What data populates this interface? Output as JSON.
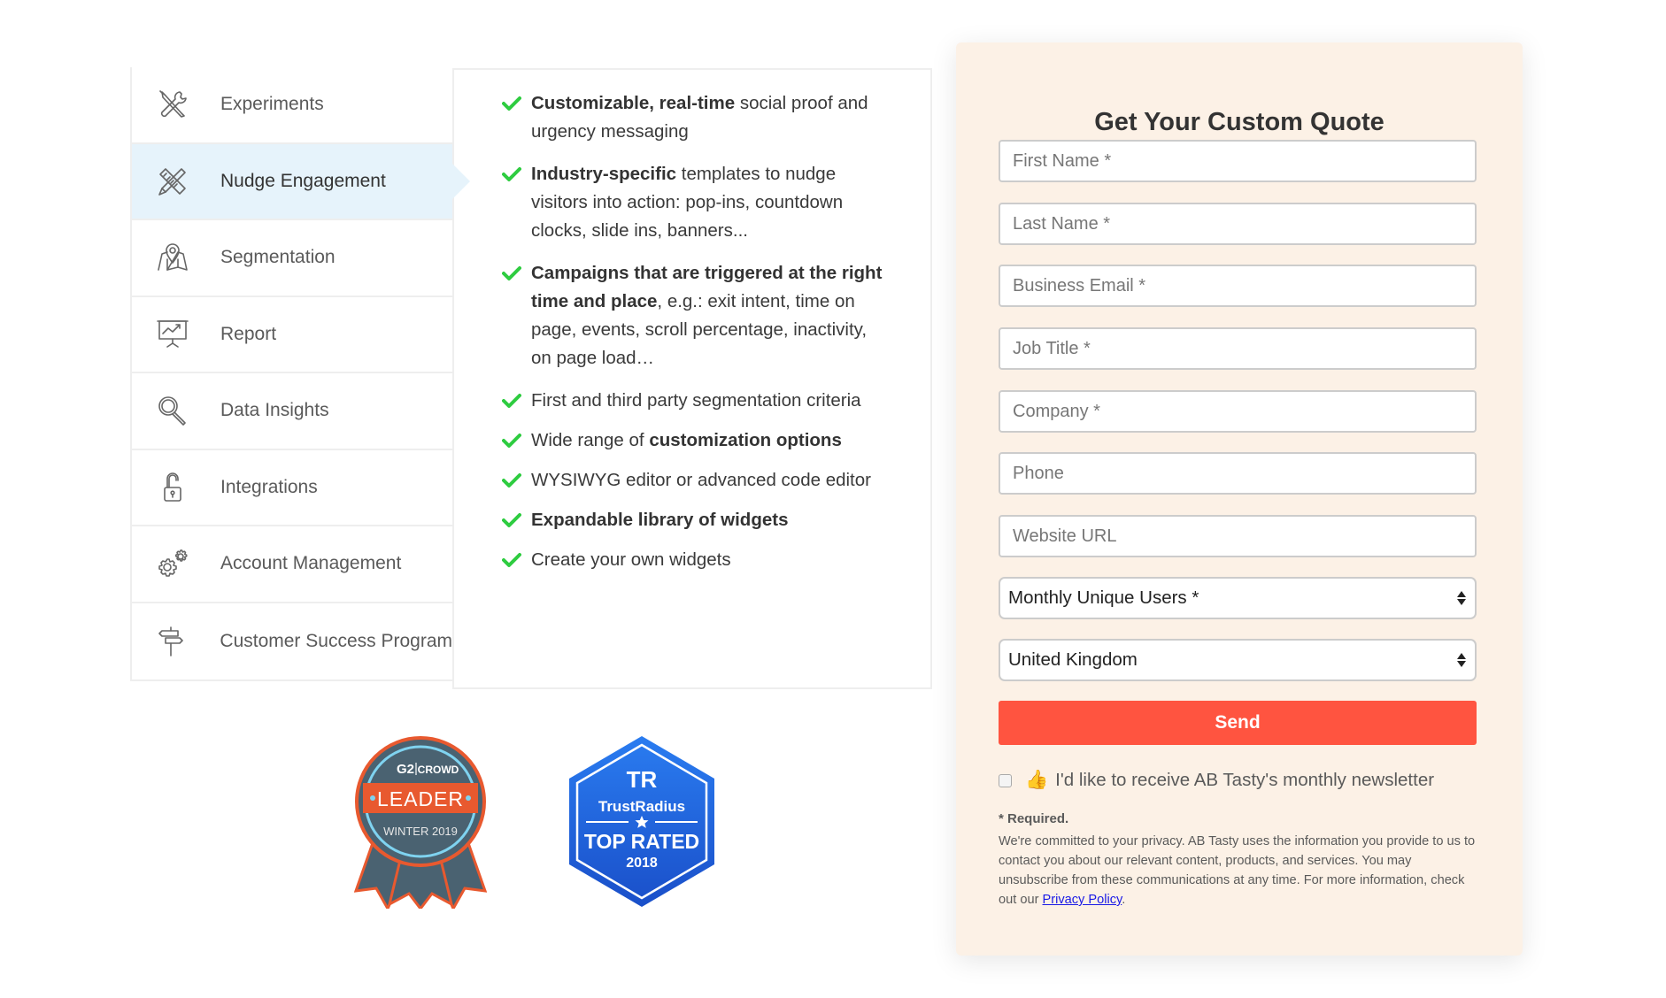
{
  "sidebar": {
    "items": [
      {
        "label": "Experiments",
        "icon": "tools-icon",
        "active": false
      },
      {
        "label": "Nudge Engagement",
        "icon": "pencil-ruler-icon",
        "active": true
      },
      {
        "label": "Segmentation",
        "icon": "map-pin-icon",
        "active": false
      },
      {
        "label": "Report",
        "icon": "presentation-chart-icon",
        "active": false
      },
      {
        "label": "Data Insights",
        "icon": "magnifier-icon",
        "active": false
      },
      {
        "label": "Integrations",
        "icon": "padlock-icon",
        "active": false
      },
      {
        "label": "Account Management",
        "icon": "gears-icon",
        "active": false
      },
      {
        "label": "Customer Success Program",
        "icon": "signpost-icon",
        "active": false
      }
    ]
  },
  "features": {
    "check_color": "#2ecc40",
    "items": [
      {
        "bold": "Customizable, real-time",
        "rest": " social proof and urgency messaging"
      },
      {
        "bold": "Industry-specific",
        "rest": " templates to nudge visitors into action: pop-ins, countdown clocks, slide ins, banners..."
      },
      {
        "bold": "Campaigns that are triggered at the right time and place",
        "rest": ", e.g.: exit intent, time on page, events, scroll percentage, inactivity, on page load…"
      },
      {
        "pre": "First and third party segmentation criteria"
      },
      {
        "pre": "Wide range of ",
        "bold": "customization options"
      },
      {
        "pre": "WYSIWYG editor or advanced code editor"
      },
      {
        "bold": "Expandable library of widgets"
      },
      {
        "pre": "Create your own widgets"
      }
    ]
  },
  "badges": {
    "g2": {
      "brand": "CROWD",
      "logo": "G2",
      "title": "LEADER",
      "season": "WINTER 2019"
    },
    "trustradius": {
      "logo": "TR",
      "brand": "TrustRadius",
      "title": "TOP RATED",
      "year": "2018"
    }
  },
  "form": {
    "title": "Get Your Custom Quote",
    "fields": [
      {
        "placeholder": "First Name *",
        "value": ""
      },
      {
        "placeholder": "Last Name *",
        "value": ""
      },
      {
        "placeholder": "Business Email *",
        "value": ""
      },
      {
        "placeholder": "Job Title *",
        "value": ""
      },
      {
        "placeholder": "Company *",
        "value": ""
      },
      {
        "placeholder": "Phone",
        "value": ""
      },
      {
        "placeholder": "Website URL",
        "value": ""
      }
    ],
    "selects": [
      {
        "selected": "Monthly Unique Users *"
      },
      {
        "selected": "United Kingdom"
      }
    ],
    "send_label": "Send",
    "send_color": "#ff5440",
    "newsletter": {
      "checked": false,
      "emoji": "👍",
      "label": "I'd like to receive AB Tasty's monthly newsletter"
    },
    "required_note": "* Required.",
    "privacy_text": "We're committed to your privacy. AB Tasty uses the information you provide to us to contact you about our relevant content, products, and services. You may unsubscribe from these communications at any time. For more information, check out our ",
    "privacy_link": "Privacy Policy",
    "privacy_end": "."
  }
}
